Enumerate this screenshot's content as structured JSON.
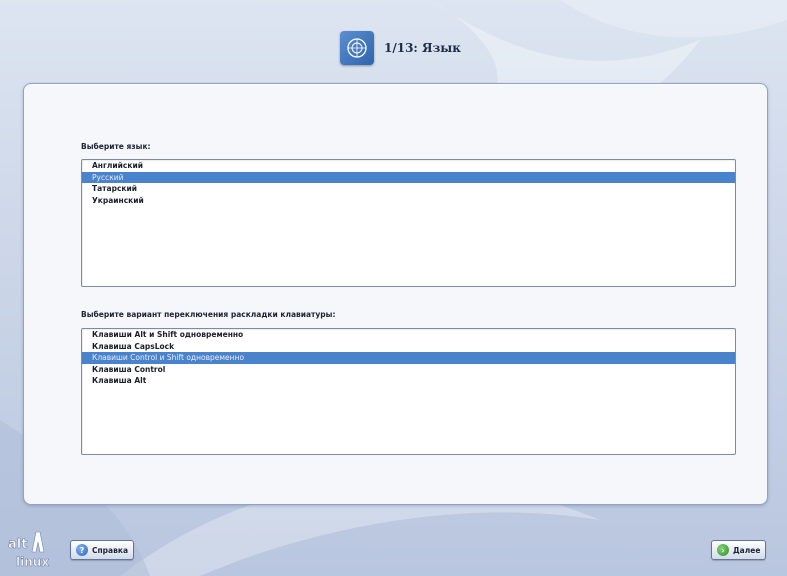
{
  "header": {
    "title": "1/13: Язык",
    "icon": "language-flag-icon"
  },
  "language": {
    "label": "Выберите язык:",
    "items": [
      "Английский",
      "Русский",
      "Татарский",
      "Украинский"
    ],
    "selected_index": 1
  },
  "keyboard": {
    "label": "Выберите вариант переключения раскладки клавиатуры:",
    "items": [
      "Клавиши Alt и Shift одновременно",
      "Клавиша CapsLock",
      "Клавиши Control и Shift одновременно",
      "Клавиша Control",
      "Клавиша Alt"
    ],
    "selected_index": 2
  },
  "footer": {
    "logo_text_top": "alt",
    "logo_text_bottom": "linux",
    "help_label": "Справка",
    "next_label": "Далее"
  },
  "colors": {
    "selection": "#4b82cc",
    "panel_border": "#8fa3c7",
    "background": "#cfd9ea"
  }
}
